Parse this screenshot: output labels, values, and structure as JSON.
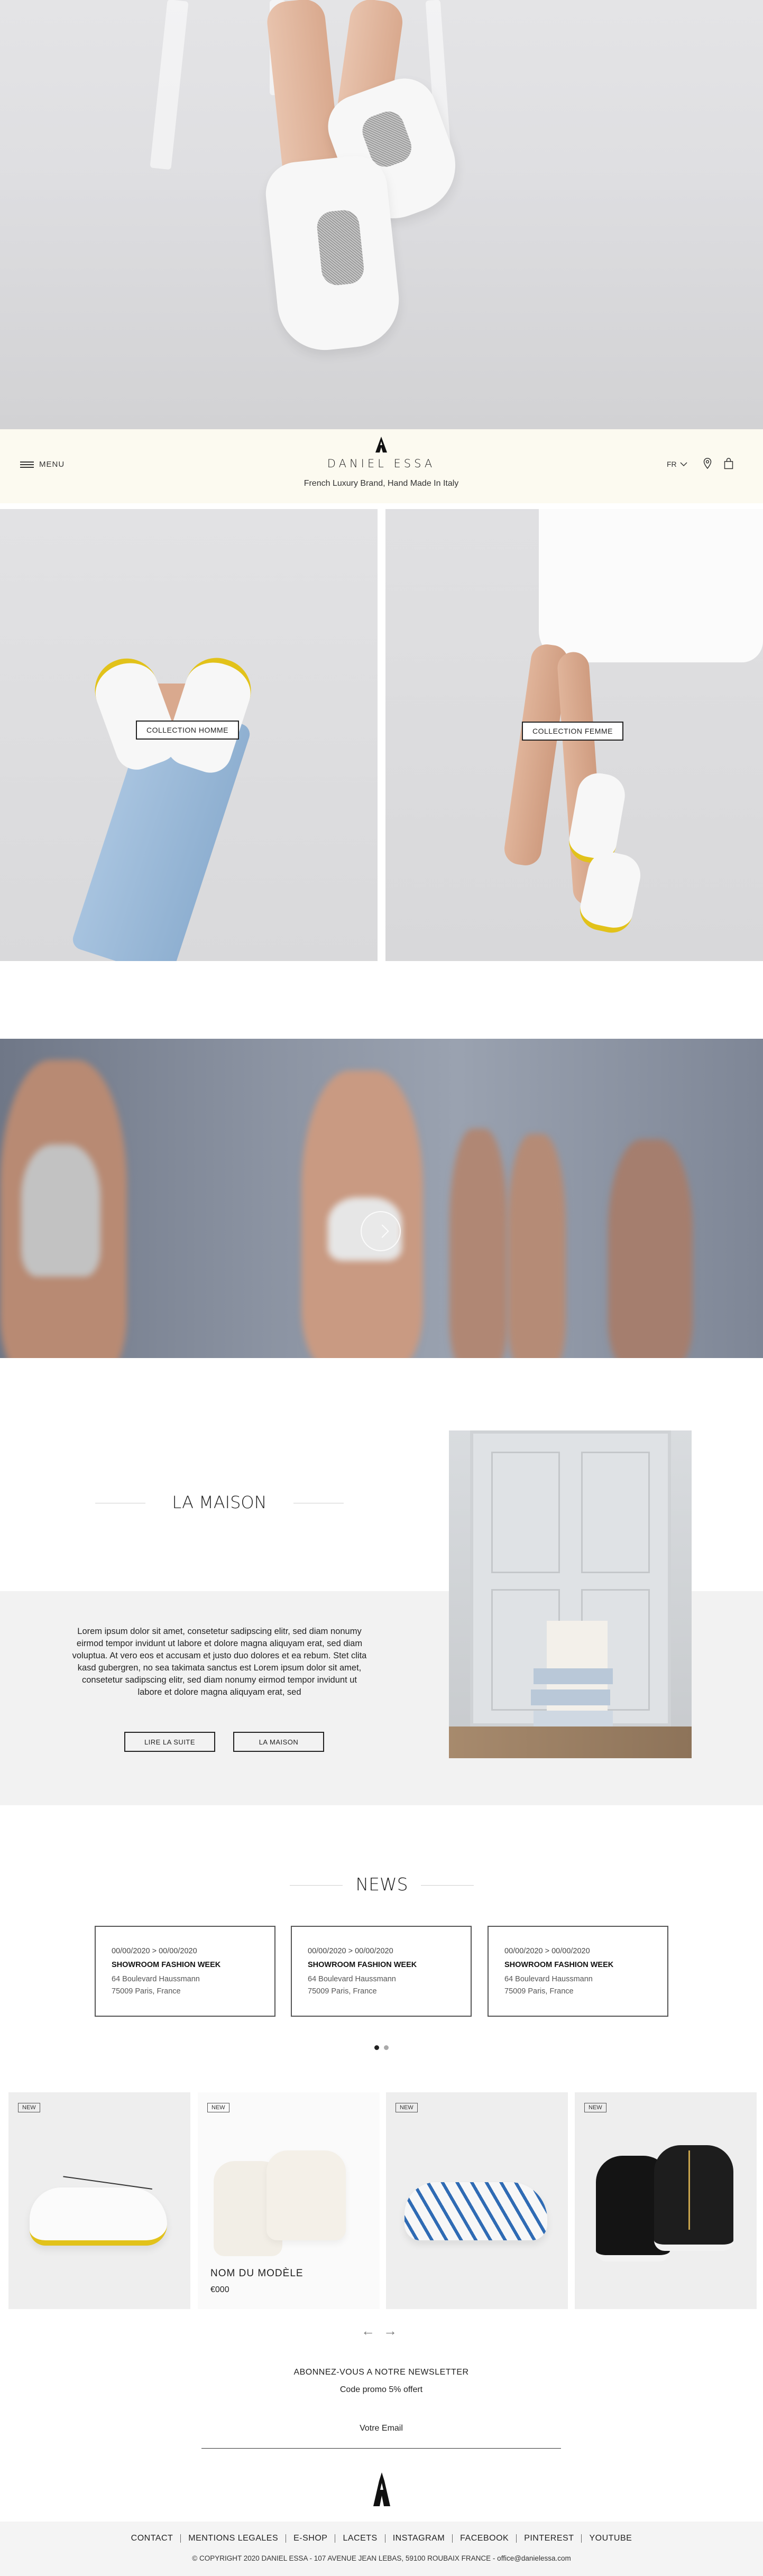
{
  "header": {
    "menu_label": "MENU",
    "brand": "DANIEL ESSA",
    "tagline": "French Luxury Brand, Hand Made In Italy",
    "language": "FR"
  },
  "collections": {
    "homme_label": "COLLECTION HOMME",
    "femme_label": "COLLECTION FEMME"
  },
  "maison": {
    "title": "LA MAISON",
    "text": "Lorem ipsum dolor sit amet, consetetur sadipscing elitr, sed diam nonumy eirmod tempor invidunt ut labore et dolore magna aliquyam erat, sed diam voluptua. At vero eos et accusam et justo duo dolores et ea rebum. Stet clita kasd gubergren, no sea takimata sanctus est Lorem ipsum dolor sit amet, consetetur sadipscing elitr, sed diam nonumy eirmod tempor invidunt ut labore et dolore magna aliquyam erat, sed",
    "read_more": "LIRE LA SUITE",
    "maison_button": "LA MAISON"
  },
  "news": {
    "title": "NEWS",
    "items": [
      {
        "date": "00/00/2020 > 00/00/2020",
        "title": "SHOWROOM FASHION WEEK",
        "address1": "64 Boulevard Haussmann",
        "address2": "75009 Paris, France"
      },
      {
        "date": "00/00/2020 > 00/00/2020",
        "title": "SHOWROOM FASHION WEEK",
        "address1": "64 Boulevard Haussmann",
        "address2": "75009 Paris, France"
      },
      {
        "date": "00/00/2020 > 00/00/2020",
        "title": "SHOWROOM FASHION WEEK",
        "address1": "64 Boulevard Haussmann",
        "address2": "75009 Paris, France"
      }
    ],
    "active_page": 1,
    "page_count": 2
  },
  "products": {
    "badge": "NEW",
    "featured_name": "NOM DU MODÈLE",
    "featured_price": "€000",
    "arrow_prev": "←",
    "arrow_next": "→"
  },
  "newsletter": {
    "title": "ABONNEZ-VOUS A NOTRE NEWSLETTER",
    "subtitle": "Code promo 5% offert",
    "placeholder": "Votre Email"
  },
  "footer": {
    "links": [
      "CONTACT",
      "MENTIONS LEGALES",
      "E-SHOP",
      "LACETS",
      "INSTAGRAM",
      "FACEBOOK",
      "PINTEREST",
      "YOUTUBE"
    ],
    "copyright": "© COPYRIGHT 2020 DANIEL ESSA - 107 AVENUE JEAN LEBAS, 59100 ROUBAIX FRANCE - office@danielessa.com"
  },
  "colors": {
    "topbar_bg": "#fcfaf0",
    "footer_bg": "#f4f4f4",
    "gray_band": "#f2f2f2",
    "accent_yellow": "#e2c21a"
  }
}
